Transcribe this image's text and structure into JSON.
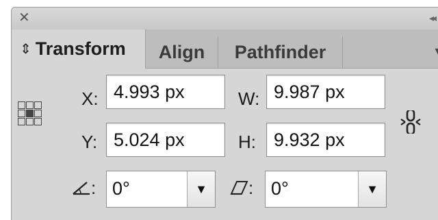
{
  "titlebar": {
    "close_glyph": "✕",
    "collapse_glyph": "◂◂"
  },
  "tabs": [
    {
      "label": "Transform",
      "active": true
    },
    {
      "label": "Align",
      "active": false
    },
    {
      "label": "Pathfinder",
      "active": false
    }
  ],
  "tab_chevron_glyph": "⌃",
  "menu_glyph": "▾≡",
  "fields": {
    "x": {
      "label": "X:",
      "value": "4.993 px"
    },
    "y": {
      "label": "Y:",
      "value": "5.024 px"
    },
    "w": {
      "label": "W:",
      "value": "9.987 px"
    },
    "h": {
      "label": "H:",
      "value": "9.932 px"
    }
  },
  "rotate": {
    "label": ":",
    "value": "0°"
  },
  "shear": {
    "label": ":",
    "value": "0°"
  },
  "dropdown_glyph": "▼",
  "icons": [
    "close-icon",
    "collapse-icon",
    "panel-menu-icon",
    "reference-point-icon",
    "constrain-proportions-link-icon",
    "rotate-angle-icon",
    "shear-angle-icon",
    "chevron-down-icon"
  ]
}
